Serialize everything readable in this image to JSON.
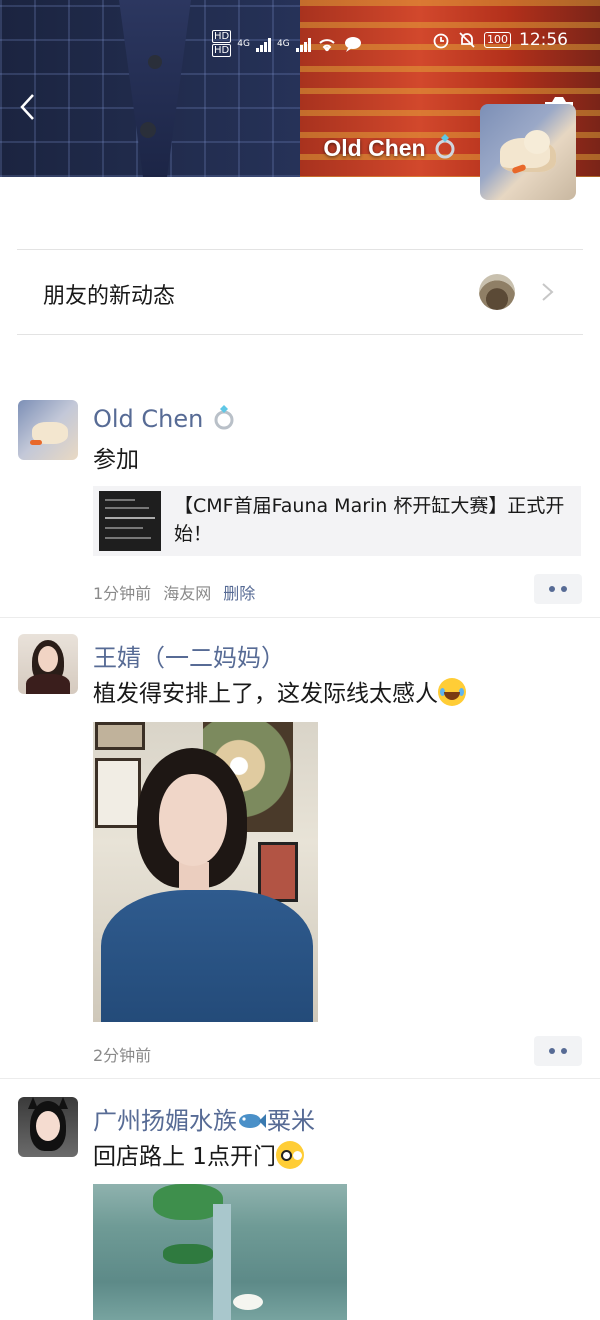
{
  "status_bar": {
    "hd1": "HD",
    "hd2": "HD",
    "net1": "4G",
    "net2": "4G",
    "battery": "100",
    "time": "12:56"
  },
  "header": {
    "profile_name": "Old Chen"
  },
  "friends_updates": {
    "label": "朋友的新动态"
  },
  "posts": [
    {
      "name": "Old Chen",
      "text": "参加",
      "link_title": "【CMF首届Fauna Marin 杯开缸大赛】正式开始！",
      "time": "1分钟前",
      "source": "海友网",
      "delete": "删除"
    },
    {
      "name": "王婧（一二妈妈）",
      "text": "植发得安排上了，这发际线太感人",
      "time": "2分钟前"
    },
    {
      "name_prefix": "广州扬媚水族",
      "name_suffix": "粟米",
      "text": "回店路上 1点开门"
    }
  ],
  "colors": {
    "link_blue": "#576b95",
    "meta_gray": "#8a8a8a",
    "card_bg": "#f3f3f5"
  },
  "icons": {
    "back": "chevron-left-icon",
    "camera": "camera-icon",
    "chevron": "chevron-right-icon",
    "more": "more-dots-icon"
  }
}
